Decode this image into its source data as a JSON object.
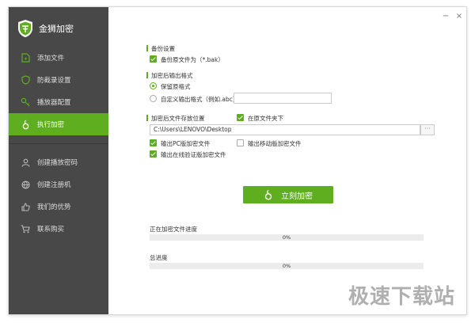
{
  "app": {
    "title": "金狮加密"
  },
  "sidebar": {
    "items": [
      {
        "label": "添加文件",
        "icon": "file-icon"
      },
      {
        "label": "防截录设置",
        "icon": "shield-icon"
      },
      {
        "label": "播放器配置",
        "icon": "key-icon"
      },
      {
        "label": "执行加密",
        "icon": "lock-icon",
        "active": true
      },
      {
        "label": "创建播放密码",
        "icon": "user-icon"
      },
      {
        "label": "创建注册机",
        "icon": "globe-icon"
      },
      {
        "label": "我们的优势",
        "icon": "thumbs-up-icon"
      },
      {
        "label": "联系购买",
        "icon": "cart-icon"
      }
    ]
  },
  "window": {
    "minimize": "−",
    "close": "×"
  },
  "backup": {
    "title": "备份设置",
    "option": "备份原文件为（*.bak）",
    "checked": true
  },
  "output_format": {
    "title": "加密后输出格式",
    "keep_label": "保留原格式",
    "custom_label": "自定义输出格式（例如.abc）",
    "custom_value": "",
    "selected": "keep"
  },
  "save_location": {
    "title": "加密后文件存放位置",
    "same_folder_label": "在原文件夹下",
    "same_folder_checked": true,
    "path": "C:\\Users\\LENOVO\\Desktop",
    "browse_label": "···"
  },
  "outputs": {
    "pc_label": "输出PC版加密文件",
    "pc_checked": true,
    "mobile_label": "输出移动版加密文件",
    "mobile_checked": false,
    "online_label": "输出在线验证版加密文件",
    "online_checked": true
  },
  "action": {
    "encrypt_label": "立刻加密"
  },
  "progress": {
    "current_label": "正在加密文件进度",
    "current_value": 0,
    "current_text": "0%",
    "total_label": "总进度",
    "total_value": 0,
    "total_text": "0%"
  },
  "watermark": {
    "text": "极速下载站"
  },
  "colors": {
    "accent": "#5fae1f",
    "sidebar": "#484848"
  }
}
